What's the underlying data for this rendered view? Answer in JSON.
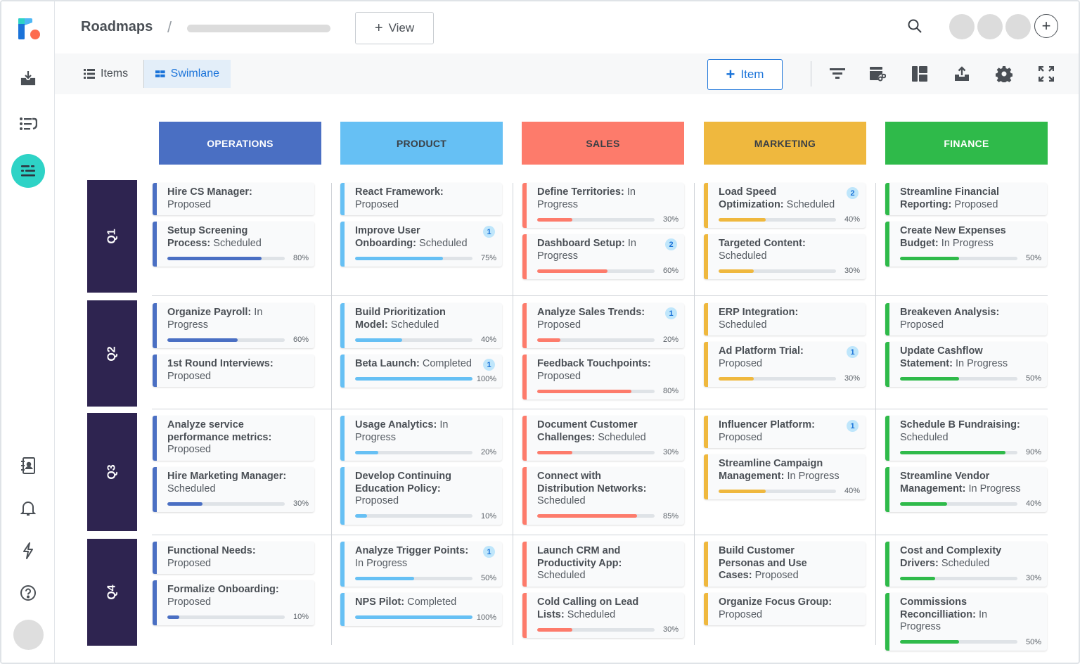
{
  "app": {
    "title": "Roadmaps",
    "view_button": "View",
    "add_item_button": "Item"
  },
  "toolbar": {
    "tabs": [
      {
        "label": "Items",
        "active": false
      },
      {
        "label": "Swimlane",
        "active": true
      }
    ],
    "icons": [
      "filter-icon",
      "roadmap-link-icon",
      "layout-icon",
      "export-icon",
      "settings-icon",
      "fullscreen-icon"
    ]
  },
  "sidebar": {
    "icons": [
      "inbox-download-icon",
      "list-return-icon",
      "roadmap-icon",
      "contacts-icon",
      "bell-icon",
      "lightning-icon",
      "help-icon"
    ]
  },
  "colors": {
    "accent": "#1a73d9",
    "lane": "#2e2450",
    "sidebar_active": "#2ed3c6"
  },
  "columns": [
    {
      "name": "OPERATIONS",
      "color": "#4a6fc3",
      "text_color": "#ffffff"
    },
    {
      "name": "PRODUCT",
      "color": "#66c0f4",
      "text_color": "#3a3f45"
    },
    {
      "name": "SALES",
      "color": "#fd7b6b",
      "text_color": "#3a3f45"
    },
    {
      "name": "MARKETING",
      "color": "#efb83e",
      "text_color": "#3a3f45"
    },
    {
      "name": "FINANCE",
      "color": "#2fba4a",
      "text_color": "#ffffff"
    }
  ],
  "lanes": [
    {
      "label": "Q1",
      "cells": [
        [
          {
            "title": "Hire CS Manager:",
            "status": "Proposed"
          },
          {
            "title": "Setup Screening Process:",
            "status": "Scheduled",
            "progress": 80
          }
        ],
        [
          {
            "title": "React Framework:",
            "status": "Proposed"
          },
          {
            "title": "Improve User Onboarding:",
            "status": "Scheduled",
            "progress": 75,
            "badge": "1"
          }
        ],
        [
          {
            "title": "Define Territories:",
            "status": "In Progress",
            "progress": 30
          },
          {
            "title": "Dashboard Setup:",
            "status": "In Progress",
            "progress": 60,
            "badge": "2"
          }
        ],
        [
          {
            "title": "Load Speed Optimization:",
            "status": "Scheduled",
            "progress": 40,
            "badge": "2"
          },
          {
            "title": "Targeted Content:",
            "status": "Scheduled",
            "progress": 30
          }
        ],
        [
          {
            "title": "Streamline Financial Reporting:",
            "status": "Proposed"
          },
          {
            "title": "Create New Expenses Budget:",
            "status": "In Progress",
            "progress": 50
          }
        ]
      ]
    },
    {
      "label": "Q2",
      "cells": [
        [
          {
            "title": "Organize Payroll:",
            "status": "In Progress",
            "progress": 60
          },
          {
            "title": "1st Round Interviews:",
            "status": "Proposed"
          }
        ],
        [
          {
            "title": "Build Prioritization Model:",
            "status": "Scheduled",
            "progress": 40
          },
          {
            "title": "Beta Launch:",
            "status": "Completed",
            "progress": 100,
            "badge": "1"
          }
        ],
        [
          {
            "title": "Analyze Sales Trends:",
            "status": "Proposed",
            "progress": 20,
            "badge": "1"
          },
          {
            "title": "Feedback Touchpoints:",
            "status": "Proposed",
            "progress": 80
          }
        ],
        [
          {
            "title": "ERP Integration:",
            "status": "Scheduled"
          },
          {
            "title": "Ad Platform Trial:",
            "status": "Proposed",
            "progress": 30,
            "badge": "1"
          }
        ],
        [
          {
            "title": "Breakeven Analysis:",
            "status": "Proposed"
          },
          {
            "title": "Update Cashflow Statement:",
            "status": "In Progress",
            "progress": 50
          }
        ]
      ]
    },
    {
      "label": "Q3",
      "cells": [
        [
          {
            "title": "Analyze service performance metrics:",
            "status": "Proposed"
          },
          {
            "title": "Hire Marketing Manager:",
            "status": "Scheduled",
            "progress": 30
          }
        ],
        [
          {
            "title": "Usage Analytics:",
            "status": "In Progress",
            "progress": 20
          },
          {
            "title": "Develop Continuing Education Policy:",
            "status": "Proposed",
            "progress": 10
          }
        ],
        [
          {
            "title": "Document Customer Challenges:",
            "status": "Scheduled",
            "progress": 30
          },
          {
            "title": "Connect with Distribution Networks:",
            "status": "Scheduled",
            "progress": 85
          }
        ],
        [
          {
            "title": "Influencer Platform:",
            "status": "Proposed",
            "badge": "1"
          },
          {
            "title": "Streamline Campaign Management:",
            "status": "In Progress",
            "progress": 40
          }
        ],
        [
          {
            "title": "Schedule B Fundraising:",
            "status": "Scheduled",
            "progress": 90
          },
          {
            "title": "Streamline Vendor Management:",
            "status": "In Progress",
            "progress": 40
          }
        ]
      ]
    },
    {
      "label": "Q4",
      "cells": [
        [
          {
            "title": "Functional Needs:",
            "status": "Proposed"
          },
          {
            "title": "Formalize Onboarding:",
            "status": "Proposed",
            "progress": 10
          }
        ],
        [
          {
            "title": "Analyze Trigger Points:",
            "status": "In Progress",
            "progress": 50,
            "badge": "1"
          },
          {
            "title": "NPS Pilot:",
            "status": "Completed",
            "progress": 100
          }
        ],
        [
          {
            "title": "Launch CRM and Productivity App:",
            "status": "Scheduled"
          },
          {
            "title": "Cold Calling on Lead Lists:",
            "status": "Scheduled",
            "progress": 30
          }
        ],
        [
          {
            "title": "Build Customer Personas and Use Cases:",
            "status": "Proposed"
          },
          {
            "title": "Organize Focus Group:",
            "status": "Proposed"
          }
        ],
        [
          {
            "title": "Cost and Complexity Drivers:",
            "status": "Scheduled",
            "progress": 30
          },
          {
            "title": "Commissions Reconcilliation:",
            "status": "In Progress",
            "progress": 50
          }
        ]
      ]
    }
  ]
}
